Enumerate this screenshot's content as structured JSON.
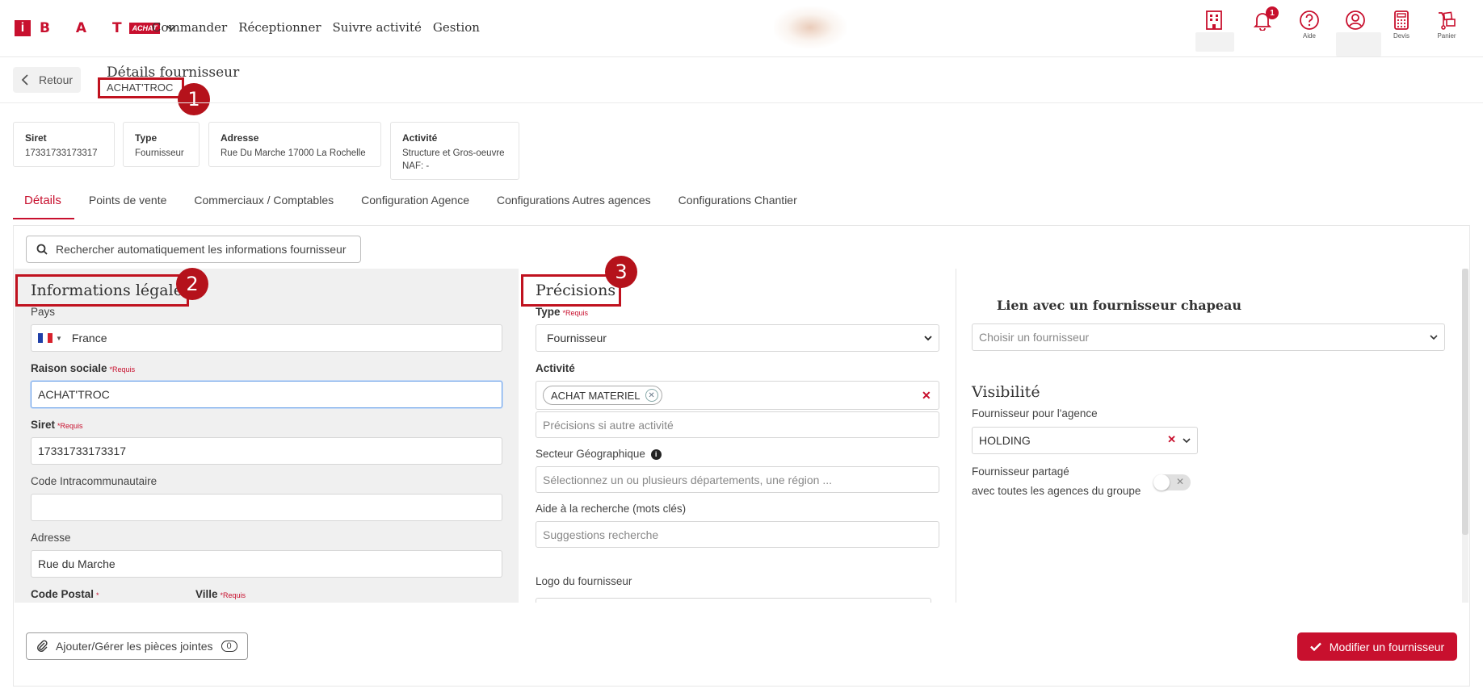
{
  "app": {
    "logo_letters": "B A T",
    "logo_tag": "ACHAT",
    "logo_i": "i"
  },
  "nav": {
    "items": [
      "Commander",
      "Réceptionner",
      "Suivre activité",
      "Gestion"
    ]
  },
  "top_icons": {
    "notifications_count": "1",
    "help_caption": "Aide",
    "quotes_caption": "Devis",
    "cart_caption": "Panier"
  },
  "header": {
    "back_label": "Retour",
    "title": "Détails fournisseur",
    "subtitle": "ACHAT'TROC"
  },
  "annotations": [
    "1",
    "2",
    "3"
  ],
  "cards": [
    {
      "label": "Siret",
      "value": "17331733173317"
    },
    {
      "label": "Type",
      "value": "Fournisseur"
    },
    {
      "label": "Adresse",
      "value": "Rue Du Marche 17000 La Rochelle"
    },
    {
      "label": "Activité",
      "value": "Structure et Gros-oeuvre",
      "value2": "NAF: -"
    }
  ],
  "tabs": [
    "Détails",
    "Points de vente",
    "Commerciaux / Comptables",
    "Configuration Agence",
    "Configurations Autres agences",
    "Configurations Chantier"
  ],
  "search_button": "Rechercher automatiquement les informations fournisseur",
  "legal": {
    "title": "Informations légales",
    "pays_label": "Pays",
    "pays_value": "France",
    "raison_label": "Raison sociale",
    "raison_value": "ACHAT'TROC",
    "siret_label": "Siret",
    "siret_value": "17331733173317",
    "intra_label": "Code Intracommunautaire",
    "intra_value": "",
    "adresse_label": "Adresse",
    "adresse_value": "Rue du Marche",
    "cp_label": "Code Postal",
    "ville_label": "Ville",
    "required_tag": "*Requis",
    "required_star": "*"
  },
  "precisions": {
    "title": "Précisions",
    "type_label": "Type",
    "type_value": "Fournisseur",
    "activite_label": "Activité",
    "activite_chip": "ACHAT MATERIEL",
    "autre_placeholder": "Précisions si autre activité",
    "secteur_label": "Secteur Géographique",
    "secteur_placeholder": "Sélectionnez un ou plusieurs départements, une région ...",
    "aide_label": "Aide à la recherche (mots clés)",
    "aide_placeholder": "Suggestions recherche",
    "logo_label": "Logo du fournisseur",
    "required_tag": "*Requis"
  },
  "right": {
    "chapeau_title": "Lien avec un fournisseur chapeau",
    "chapeau_placeholder": "Choisir un fournisseur",
    "visibilite_title": "Visibilité",
    "agence_label": "Fournisseur pour l'agence",
    "agence_value": "HOLDING",
    "partage_line1": "Fournisseur partagé",
    "partage_line2": "avec toutes les agences du groupe"
  },
  "footer": {
    "attach_label": "Ajouter/Gérer les pièces jointes",
    "attach_count": "0",
    "submit_label": "Modifier un fournisseur"
  },
  "colors": {
    "brand": "#c8102e",
    "annotation": "#b5121b"
  }
}
